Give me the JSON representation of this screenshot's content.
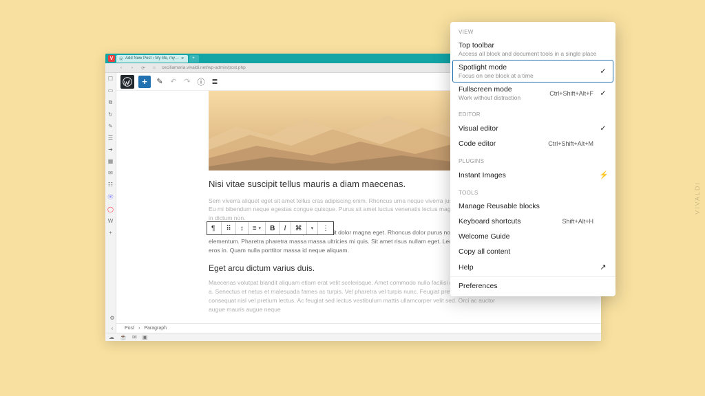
{
  "browser": {
    "name": "Vivaldi",
    "tab_title": "Add New Post ‹ My life, my…",
    "url": "ceciliamaria.vivaldi.net/wp-admin/post.php"
  },
  "wp_toolbar": {
    "add_tooltip": "Add block"
  },
  "float_toolbar": {
    "bold": "B",
    "italic": "I"
  },
  "article": {
    "h2": "Nisi vitae suscipit tellus mauris a diam maecenas.",
    "p1": "Sem viverra aliquet eget sit amet tellus cras adipiscing enim. Rhoncus urna neque viverra justo nec ultrices dui. Eu mi bibendum neque egestas congue quisque. Purus sit amet luctus venenatis lectus magna fringilla. Id neque in dictum non.",
    "p2": "Pharetra massa massa ultricies mi quis hendrerit dolor magna eget. Rhoncus dolor purus non enim praesent elementum. Pharetra pharetra massa massa ultricies mi quis. Sit amet risus nullam eget. Lectus mauris ultrices eros in. Quam nulla porttitor massa id neque aliquam.",
    "h3": "Eget arcu dictum varius duis.",
    "p3": "Maecenas volutpat blandit aliquam etiam erat velit scelerisque. Amet commodo nulla facilisi nullam vehicula ipsum a. Senectus et netus et malesuada fames ac turpis. Vel pharetra vel turpis nunc. Feugiat pretium nibh ipsum consequat nisl vel pretium lectus. Ac feugiat sed lectus vestibulum mattis ullamcorper velit sed. Orci ac auctor augue mauris augue neque"
  },
  "breadcrumb": {
    "root": "Post",
    "current": "Paragraph"
  },
  "panel": {
    "sections": {
      "view": "View",
      "editor": "Editor",
      "plugins": "Plugins",
      "tools": "Tools"
    },
    "top_toolbar": {
      "title": "Top toolbar",
      "desc": "Access all block and document tools in a single place"
    },
    "spotlight": {
      "title": "Spotlight mode",
      "desc": "Focus on one block at a time"
    },
    "fullscreen": {
      "title": "Fullscreen mode",
      "desc": "Work without distraction",
      "shortcut": "Ctrl+Shift+Alt+F"
    },
    "visual_editor": "Visual editor",
    "code_editor": {
      "title": "Code editor",
      "shortcut": "Ctrl+Shift+Alt+M"
    },
    "instant_images": "Instant Images",
    "manage_reusable": "Manage Reusable blocks",
    "keyboard": {
      "title": "Keyboard shortcuts",
      "shortcut": "Shift+Alt+H"
    },
    "welcome": "Welcome Guide",
    "copy_all": "Copy all content",
    "help": "Help",
    "preferences": "Preferences"
  },
  "watermark": "VIVALDI"
}
